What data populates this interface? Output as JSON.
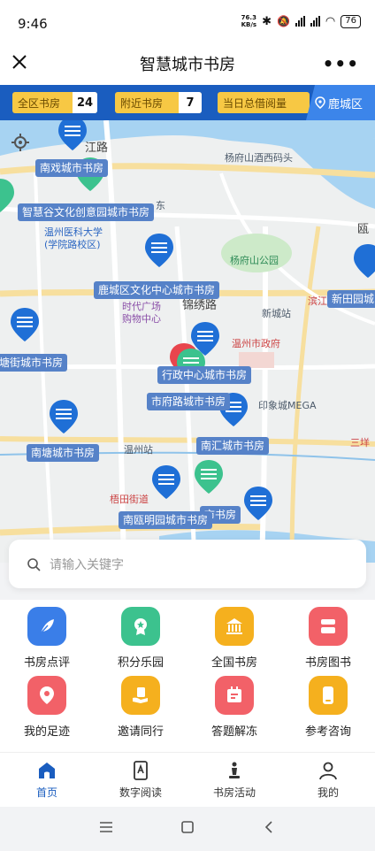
{
  "status": {
    "time": "9:46",
    "netspeed_value": "76.3",
    "netspeed_unit": "KB/s",
    "battery": "76"
  },
  "titlebar": {
    "title": "智慧城市书房",
    "more": "•••"
  },
  "stats": {
    "total_label": "全区书房",
    "total_value": "24",
    "nearby_label": "附近书房",
    "nearby_value": "7",
    "today_label": "当日总借阅量",
    "district": "鹿城区"
  },
  "map": {
    "libraries": [
      "南戏城市书房",
      "智慧谷文化创意园城市书房",
      "鹿城区文化中心城市书房",
      "塘街城市书房",
      "行政中心城市书房",
      "市府路城市书房",
      "南塘城市书房",
      "南汇城市书房",
      "新田园城",
      "南瓯明园城市书房",
      "市书房"
    ],
    "pois": {
      "yangfu": "杨府山酒西码头",
      "hospital": "温州医科大学\n(学院路校区)",
      "yangfu_park": "杨府山公园",
      "shidai": "时代广场\n购物中心",
      "jinxiu": "锦绣路",
      "xincheng": "新城站",
      "gov": "温州市政府",
      "mega": "印象城MEGA",
      "station": "温州站",
      "sanyang": "三垟",
      "wutian": "梧田街道",
      "binjiang": "滨江",
      "jianglu": "江路",
      "dongy": "东",
      "ou": "瓯"
    }
  },
  "search": {
    "placeholder": "请输入关键字"
  },
  "grid": [
    {
      "label": "书房点评",
      "color": "#3a7ee8"
    },
    {
      "label": "积分乐园",
      "color": "#3cc28e"
    },
    {
      "label": "全国书房",
      "color": "#f5b01e"
    },
    {
      "label": "书房图书",
      "color": "#f26168"
    },
    {
      "label": "我的足迹",
      "color": "#f26168"
    },
    {
      "label": "邀请同行",
      "color": "#f5b01e"
    },
    {
      "label": "答题解冻",
      "color": "#f26168"
    },
    {
      "label": "参考咨询",
      "color": "#f5b01e"
    }
  ],
  "nav": {
    "home": "首页",
    "reading": "数字阅读",
    "activities": "书房活动",
    "mine": "我的",
    "active_color": "#1a5dbf"
  }
}
